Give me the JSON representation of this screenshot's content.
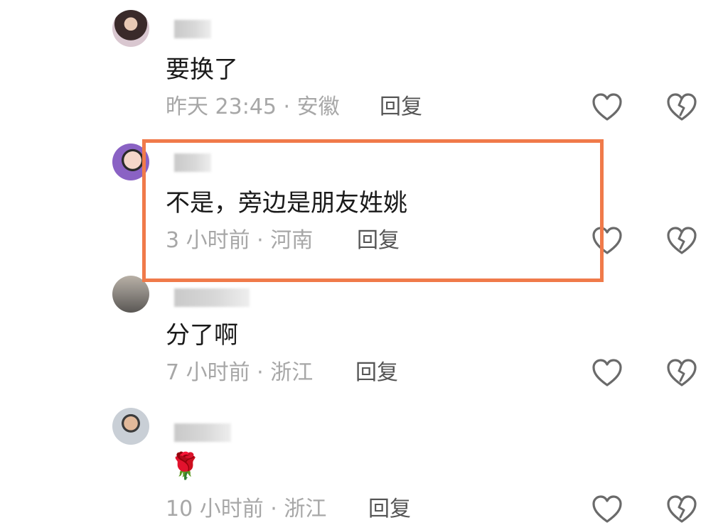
{
  "comments": [
    {
      "text": "要换了",
      "time_location": "昨天 23:45 · 安徽",
      "reply_label": "回复"
    },
    {
      "text": "不是，旁边是朋友姓姚",
      "time_location": "3 小时前 · 河南",
      "reply_label": "回复"
    },
    {
      "text": "分了啊",
      "time_location": "7 小时前 · 浙江",
      "reply_label": "回复"
    },
    {
      "text": "🌹",
      "time_location": "10 小时前 · 浙江",
      "reply_label": "回复"
    }
  ],
  "colors": {
    "highlight_border": "#f07a4a",
    "meta_text": "#a7a7a7",
    "reply_text": "#555555",
    "icon_stroke": "#6a6a6a"
  },
  "icons": {
    "like": "heart-icon",
    "dislike": "broken-heart-icon"
  }
}
